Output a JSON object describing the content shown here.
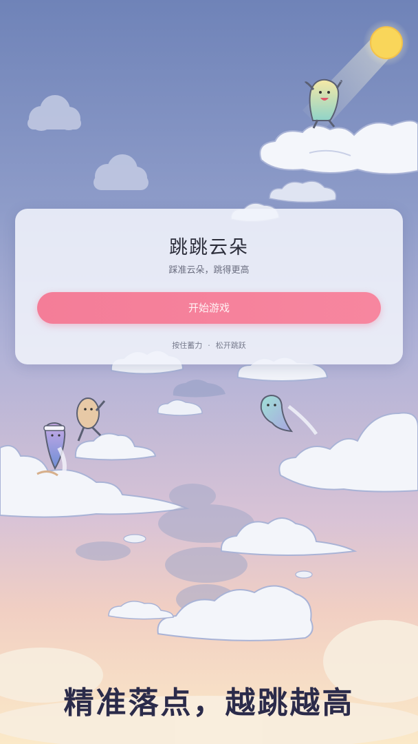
{
  "game": {
    "title": "跳跳云朵",
    "subtitle": "踩准云朵，跳得更高",
    "start_button": "开始游戏",
    "hint_press": "按住蓄力",
    "hint_separator": "·",
    "hint_release": "松开跳跃",
    "tagline": "精准落点，越跳越高"
  },
  "scene": {
    "icons": [
      "sun-icon",
      "cloud-icon",
      "jumping-character-icon"
    ],
    "colors": {
      "sky_top": "#6f83b8",
      "sky_bottom": "#fbe9c8",
      "button": "#f47d98",
      "sun": "#f9d65a"
    }
  }
}
